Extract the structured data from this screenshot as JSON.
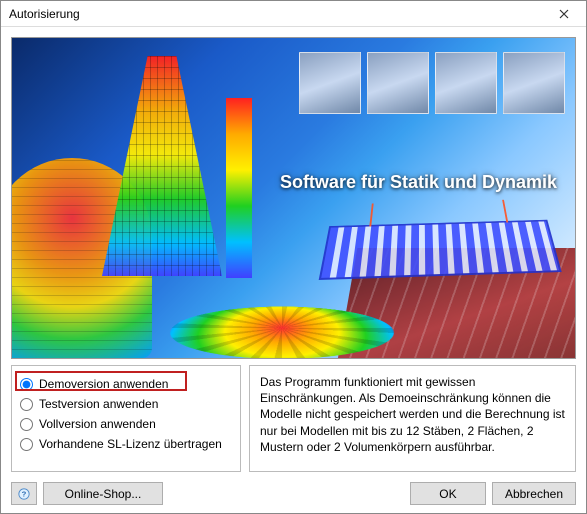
{
  "window": {
    "title": "Autorisierung"
  },
  "banner": {
    "caption": "Software für Statik und Dynamik"
  },
  "options": [
    {
      "label": "Demoversion anwenden",
      "selected": true
    },
    {
      "label": "Testversion anwenden",
      "selected": false
    },
    {
      "label": "Vollversion anwenden",
      "selected": false
    },
    {
      "label": "Vorhandene SL-Lizenz übertragen",
      "selected": false
    }
  ],
  "description": "Das Programm funktioniert mit gewissen Einschränkungen. Als Demoeinschränkung können die Modelle nicht gespeichert werden und die Berechnung ist nur bei Modellen mit bis zu 12 Stäben, 2 Flächen, 2 Mustern oder 2 Volumenkörpern ausführbar.",
  "footer": {
    "help_icon": "help-icon",
    "shop_label": "Online-Shop...",
    "ok_label": "OK",
    "cancel_label": "Abbrechen"
  }
}
